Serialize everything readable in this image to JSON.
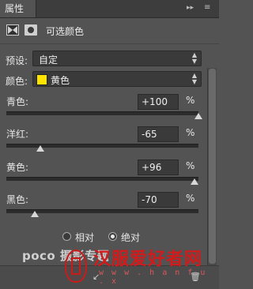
{
  "panel": {
    "tab_label": "属性",
    "collapse_icon": "double-chevron-right-icon",
    "menu_icon": "panel-menu-icon"
  },
  "header": {
    "title": "可选颜色",
    "adjustment_icon": "selective-color-adjustment-icon",
    "mask_icon": "layer-mask-icon"
  },
  "preset": {
    "label": "预设:",
    "value": "自定"
  },
  "colors": {
    "label": "颜色:",
    "value": "黄色",
    "swatch_color": "#ffe400"
  },
  "sliders": [
    {
      "label": "青色:",
      "value": "+100",
      "unit": "%",
      "level": 100
    },
    {
      "label": "洋红:",
      "value": "-65",
      "unit": "%",
      "level": -65
    },
    {
      "label": "黄色:",
      "value": "+96",
      "unit": "%",
      "level": 96
    },
    {
      "label": "黑色:",
      "value": "-70",
      "unit": "%",
      "level": -70
    }
  ],
  "method": {
    "options": [
      "相对",
      "绝对"
    ],
    "selected": "绝对"
  },
  "watermarks": {
    "poco": "poco 摄影专题",
    "site": "汉服爱好者网",
    "url": "w w w . h a n f u . x"
  }
}
